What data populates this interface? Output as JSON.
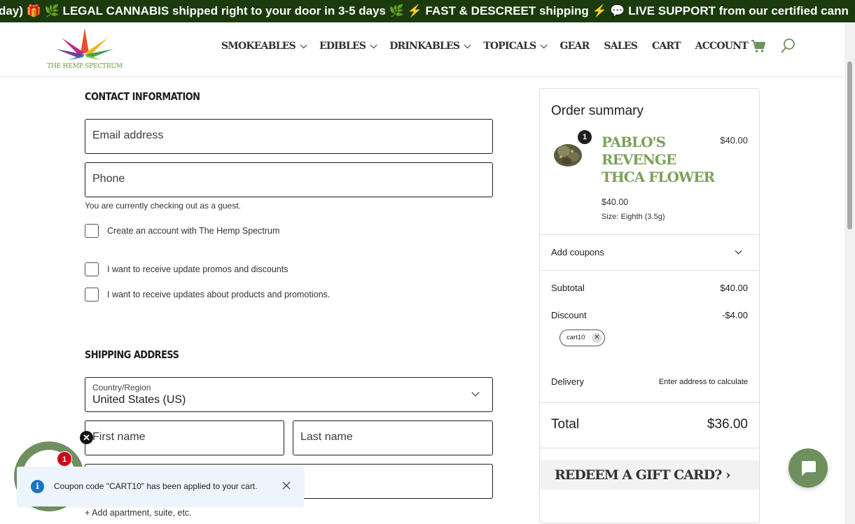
{
  "announcement": "day) 🎁 🌿 LEGAL CANNABIS shipped right to your door in 3-5 days 🌿 ⚡ FAST & DESCREET shipping ⚡ 💬 LIVE SUPPORT from our certified cann",
  "brand": {
    "logo_text": "THE HEMP SPECTRUM",
    "accent": "#7da05c",
    "dark_green": "#1b3a0d"
  },
  "nav": {
    "smokeables": "SMOKEABLES",
    "edibles": "EDIBLES",
    "drinkables": "DRINKABLES",
    "topicals": "TOPICALS",
    "gear": "GEAR",
    "sales": "SALES",
    "cart": "CART",
    "account": "ACCOUNT",
    "cart_icon": "cart-icon",
    "search_icon": "search-icon"
  },
  "contact": {
    "title": "CONTACT INFORMATION",
    "email_placeholder": "Email address",
    "phone_placeholder": "Phone",
    "guest_note": "You are currently checking out as a guest.",
    "create_account": "Create an account with The Hemp Spectrum",
    "promos": "I want to receive update promos and discounts",
    "updates": "I want to receive updates about products and promotions."
  },
  "shipping": {
    "title": "SHIPPING ADDRESS",
    "country_label": "Country/Region",
    "country_value": "United States (US)",
    "first_name": "First name",
    "last_name": "Last name",
    "add_apartment": "+ Add apartment, suite, etc."
  },
  "summary": {
    "title": "Order summary",
    "quantity": "1",
    "product_name": "PABLO'S REVENGE THCA FLOWER",
    "line_price": "$40.00",
    "unit_price": "$40.00",
    "size": "Size: Eighth (3.5g)",
    "add_coupons": "Add coupons",
    "subtotal_label": "Subtotal",
    "subtotal_value": "$40.00",
    "discount_label": "Discount",
    "discount_value": "-$4.00",
    "coupon_chip": "cart10",
    "delivery_label": "Delivery",
    "delivery_value": "Enter address to calculate",
    "total_label": "Total",
    "total_value": "$36.00",
    "gift_card": "REDEEM A GIFT CARD? ›"
  },
  "widgets": {
    "rewards_badge": "1",
    "toast_text": "Coupon code \"CART10\" has been applied to your cart."
  }
}
